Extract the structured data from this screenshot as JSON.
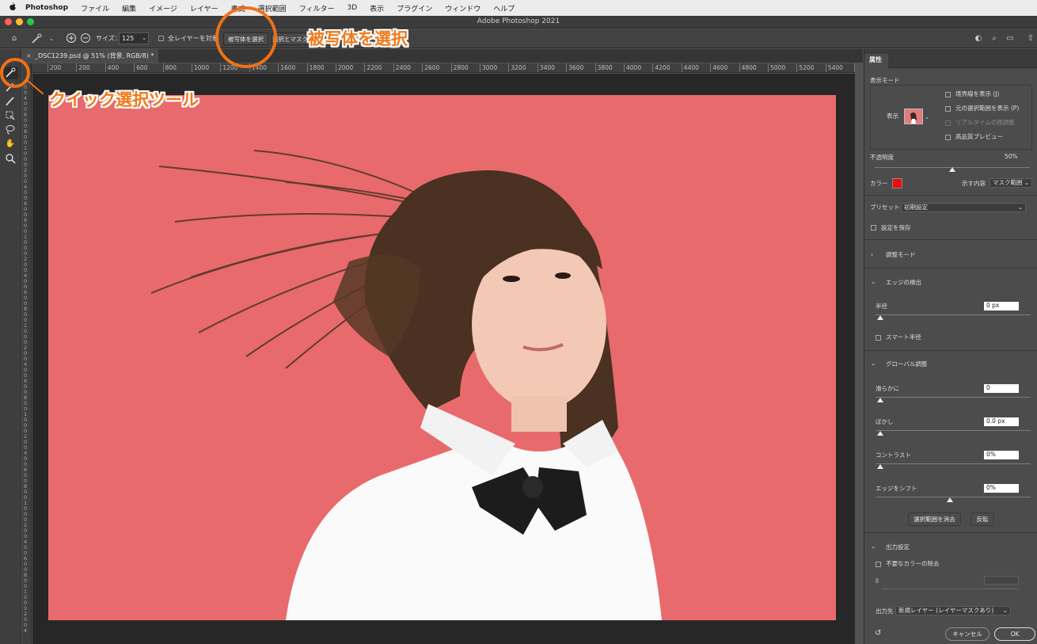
{
  "menubar": {
    "apple_icon": "apple-icon",
    "items": [
      "Photoshop",
      "ファイル",
      "編集",
      "イメージ",
      "レイヤー",
      "書式",
      "選択範囲",
      "フィルター",
      "3D",
      "表示",
      "プラグイン",
      "ウィンドウ",
      "ヘルプ"
    ]
  },
  "window": {
    "title": "Adobe Photoshop 2021"
  },
  "options": {
    "size_label": "サイズ：",
    "size_value": "125",
    "all_layers_label": "全レイヤーを対象",
    "select_subject_label": "被写体を選択",
    "select_and_mask_label": "選択とマスク..."
  },
  "document": {
    "tab_label": "_DSC1239.psd @ 51% (背景, RGB/8) *",
    "close_glyph": "×"
  },
  "ruler": {
    "top_labels": [
      "200",
      "200",
      "400",
      "600",
      "800",
      "1000",
      "1200",
      "1400",
      "1600",
      "1800",
      "2000",
      "2200",
      "2400",
      "2600",
      "2800",
      "3000",
      "3200",
      "3400",
      "3600",
      "3800",
      "4000",
      "4200",
      "4400",
      "4600",
      "4800",
      "5000",
      "5200",
      "5400",
      "56"
    ]
  },
  "panel": {
    "tab": "属性",
    "view_mode_title": "表示モード",
    "view_label": "表示",
    "show_edge_label": "境界線を表示 (J)",
    "show_original_label": "元の選択範囲を表示 (P)",
    "realtime_label": "リアルタイムの微調整",
    "hq_preview_label": "高品質プレビュー",
    "opacity_label": "不透明度",
    "opacity_value": "50%",
    "opacity_level": 0.5,
    "color_label": "カラー",
    "color_swatch": "#e81010",
    "indicates_label": "示す内容",
    "indicates_value": "マスク範囲",
    "preset_label": "プリセット",
    "preset_value": "初期設定",
    "remember_label": "設定を保存",
    "adjust_mode_label": "調整モード",
    "edge_detect_label": "エッジの検出",
    "radius_label": "半径",
    "radius_value": "0 px",
    "smart_radius_label": "スマート半径",
    "global_label": "グローバル調整",
    "smooth_label": "滑らかに",
    "smooth_value": "0",
    "feather_label": "ぼかし",
    "feather_value": "0.0 px",
    "contrast_label": "コントラスト",
    "contrast_value": "0%",
    "shift_label": "エッジをシフト",
    "shift_value": "0%",
    "clear_selection_label": "選択範囲を消去",
    "invert_label": "反転",
    "output_settings_label": "出力設定",
    "decontaminate_label": "不要なカラーの除去",
    "output_to_label": "出力先",
    "output_to_value": "新規レイヤー (レイヤーマスクあり)",
    "cancel_label": "キャンセル",
    "ok_label": "OK"
  },
  "annotations": {
    "select_subject_text": "被写体を選択",
    "quick_select_text": "クイック選択ツール",
    "accent_color": "#f07018"
  },
  "colors": {
    "backdrop": "#e86a6c"
  }
}
